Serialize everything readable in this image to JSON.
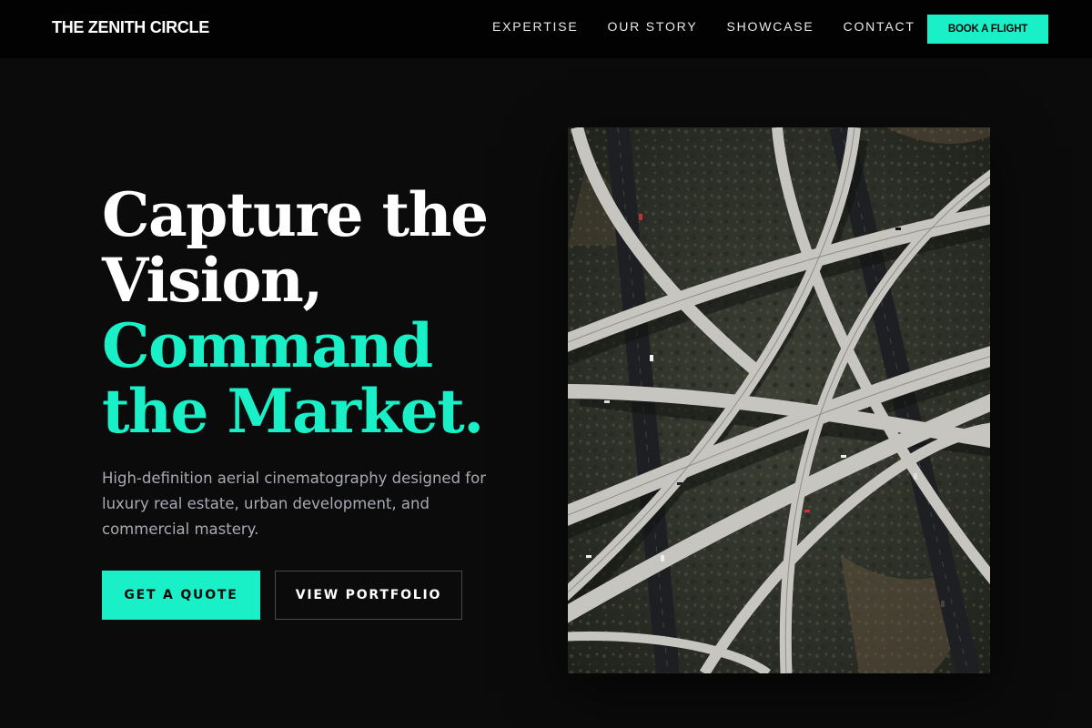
{
  "nav": {
    "brand": "THE ZENITH CIRCLE",
    "links": [
      "EXPERTISE",
      "OUR STORY",
      "SHOWCASE",
      "CONTACT"
    ],
    "cta": "BOOK A FLIGHT"
  },
  "hero": {
    "headline": {
      "line1": "Capture the",
      "line2": "Vision,",
      "line3": "Command",
      "line4": "the Market."
    },
    "subtext": "High-definition aerial cinematography designed for luxury real estate, urban development, and commercial mastery.",
    "buttons": {
      "quote": "GET A QUOTE",
      "portfolio": "VIEW PORTFOLIO"
    },
    "image": {
      "subject": "aerial view of highway interchange overpasses"
    }
  },
  "colors": {
    "accent": "#19f0c8",
    "background": "#0b0b0b",
    "nav_background": "#020202",
    "subtext": "#a6aab2"
  }
}
